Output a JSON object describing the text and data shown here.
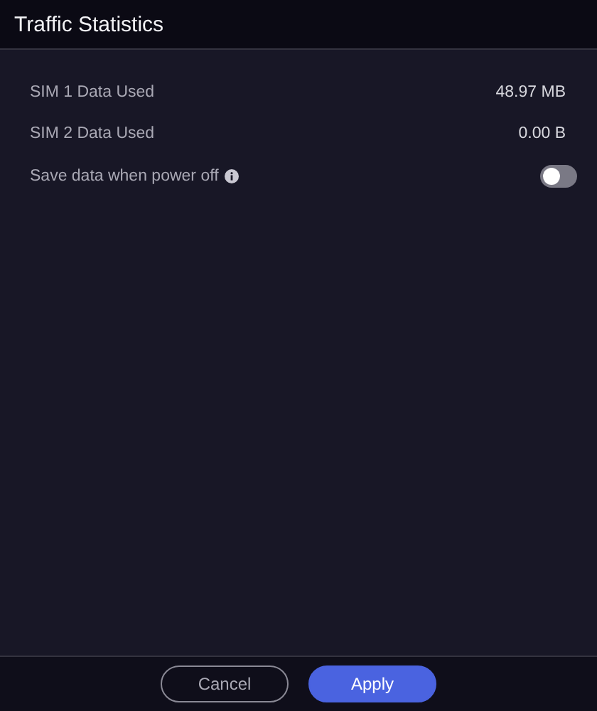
{
  "window": {
    "title": "Traffic Statistics"
  },
  "rows": [
    {
      "kind": "value",
      "label": "SIM 1 Data Used",
      "value": "48.97 MB"
    },
    {
      "kind": "value",
      "label": "SIM 2 Data Used",
      "value": "0.00 B"
    },
    {
      "kind": "toggle",
      "label": "Save data when power off",
      "info": true,
      "on": false
    }
  ],
  "buttons": [
    {
      "label": "Cancel",
      "kind": "secondary"
    },
    {
      "label": "Apply",
      "kind": "primary"
    }
  ]
}
